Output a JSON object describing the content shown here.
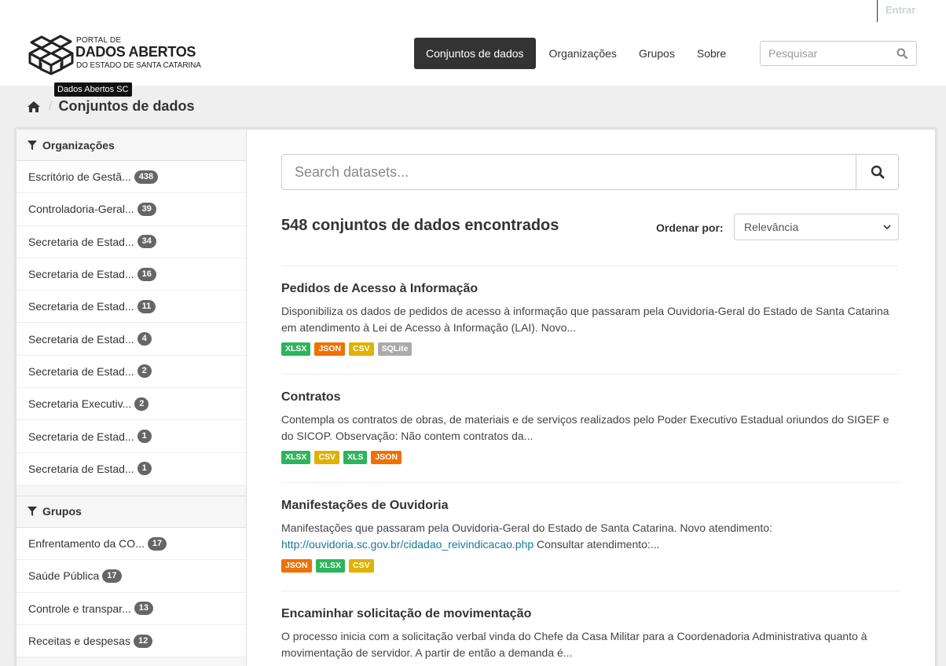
{
  "topbar": {
    "login": "Entrar"
  },
  "brand": {
    "line1": "PORTAL DE",
    "line2": "DADOS ABERTOS",
    "line3": "DO ESTADO DE SANTA CATARINA",
    "tooltip": "Dados Abertos SC"
  },
  "nav": {
    "items": [
      "Conjuntos de dados",
      "Organizações",
      "Grupos",
      "Sobre"
    ],
    "search_placeholder": "Pesquisar"
  },
  "breadcrumb": {
    "current": "Conjuntos de dados"
  },
  "sidebar": {
    "organizations": {
      "title": "Organizações",
      "items": [
        {
          "label": "Escritório de Gestã...",
          "count": "438"
        },
        {
          "label": "Controladoria-Geral...",
          "count": "39"
        },
        {
          "label": "Secretaria de Estad...",
          "count": "34"
        },
        {
          "label": "Secretaria de Estad...",
          "count": "16"
        },
        {
          "label": "Secretaria de Estad...",
          "count": "11"
        },
        {
          "label": "Secretaria de Estad...",
          "count": "4"
        },
        {
          "label": "Secretaria de Estad...",
          "count": "2"
        },
        {
          "label": "Secretaria Executiv...",
          "count": "2"
        },
        {
          "label": "Secretaria de Estad...",
          "count": "1"
        },
        {
          "label": "Secretaria de Estad...",
          "count": "1"
        }
      ]
    },
    "groups": {
      "title": "Grupos",
      "items": [
        {
          "label": "Enfrentamento da CO...",
          "count": "17"
        },
        {
          "label": "Saúde Pública",
          "count": "17"
        },
        {
          "label": "Controle e transpar...",
          "count": "13"
        },
        {
          "label": "Receitas e despesas",
          "count": "12"
        }
      ]
    }
  },
  "main": {
    "search_placeholder": "Search datasets...",
    "result_count": "548 conjuntos de dados encontrados",
    "sort_label": "Ordenar por:",
    "sort_value": "Relevância",
    "datasets": [
      {
        "title": "Pedidos de Acesso à Informação",
        "desc": "Disponibiliza os dados de pedidos de acesso à informação que passaram pela Ouvidoria-Geral do Estado de Santa Catarina em atendimento à Lei de Acesso à Informação (LAI). Novo...",
        "link": "",
        "desc_after": "",
        "formats": [
          "XLSX",
          "JSON",
          "CSV",
          "SQLite"
        ]
      },
      {
        "title": "Contratos",
        "desc": "Contempla os contratos de obras, de materiais e de serviços realizados pelo Poder Executivo Estadual oriundos do SIGEF e do SICOP. Observação: Não contem contratos da...",
        "link": "",
        "desc_after": "",
        "formats": [
          "XLSX",
          "CSV",
          "XLS",
          "JSON"
        ]
      },
      {
        "title": "Manifestações de Ouvidoria",
        "desc": "Manifestações que passaram pela Ouvidoria-Geral do Estado de Santa Catarina. Novo atendimento: ",
        "link": "http://ouvidoria.sc.gov.br/cidadao_reivindicacao.php",
        "desc_after": " Consultar atendimento:...",
        "formats": [
          "JSON",
          "XLSX",
          "CSV"
        ]
      },
      {
        "title": "Encaminhar solicitação de movimentação",
        "desc": "O processo inicia com a solicitação verbal vinda do Chefe da Casa Militar para a Coordenadoria Administrativa quanto à movimentação de servidor. A partir de então a demanda é...",
        "link": "",
        "desc_after": "",
        "formats": []
      }
    ]
  },
  "format_colors": {
    "XLSX": "#2db55d",
    "XLS": "#2db55d",
    "JSON": "#ef7100",
    "CSV": "#dfb100",
    "SQLite": "#aaaaaa"
  }
}
